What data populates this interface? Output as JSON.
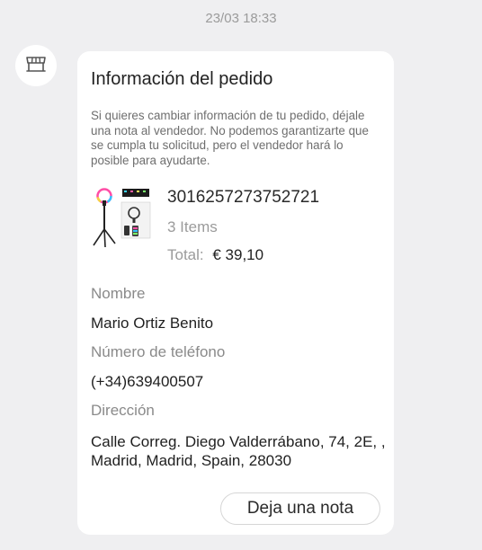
{
  "timestamp": "23/03 18:33",
  "avatar": {
    "icon": "store-icon"
  },
  "order_card": {
    "title": "Información del pedido",
    "description": "Si quieres cambiar información de tu pedido, déjale una nota al vendedor. No podemos garantizarte que se cumpla tu solicitud, pero el vendedor hará lo posible para ayudarte.",
    "product_image": "ring-light-tripod-image",
    "order_number": "3016257273752721",
    "items_count": "3 Items",
    "total_label": "Total:",
    "total_value": "€ 39,10",
    "name_label": "Nombre",
    "name_value": "Mario Ortiz Benito",
    "phone_label": "Número de teléfono",
    "phone_value": "(+34)639400507",
    "address_label": "Dirección",
    "address_value": "Calle Correg. Diego Valderrábano, 74, 2E, , Madrid, Madrid, Spain, 28030",
    "note_button_label": "Deja una nota"
  }
}
